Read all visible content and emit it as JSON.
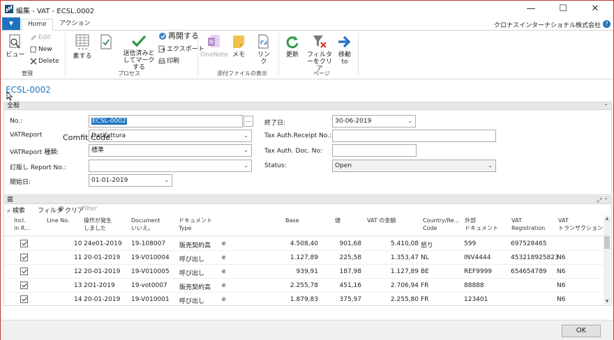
{
  "window": {
    "title": "編集 - VAT - ECSL.0002",
    "minimize": "—",
    "maximize": "☐",
    "close": "✕"
  },
  "ribbon": {
    "app_menu": "▼",
    "tabs": [
      "Home",
      "アクション"
    ],
    "company": "クロナスインターナショナル株式会社",
    "help": "?",
    "manage": {
      "view": "ビュー",
      "edit": "Edit",
      "new": "New",
      "delete": "Delete",
      "group": "管理"
    },
    "process": {
      "suggest": "素する",
      "mark_sent": "送信済みとしてマークする",
      "mark_sent_l1": "送信済みと",
      "mark_sent_l2": "してマークする",
      "reopen": "再開する",
      "export": "エクスポート",
      "print": "印刷",
      "group": "プロセス"
    },
    "attachments": {
      "onenote": "OneNote",
      "note": "メモ",
      "link": "リンク",
      "group": "添付ファイルの表示"
    },
    "page": {
      "refresh": "更新",
      "clear_filter_l1": "フィルタ",
      "clear_filter_l2": "ーをクリア",
      "goto_l1": "移動",
      "goto_l2": "to",
      "group": "ページ"
    }
  },
  "page_title": "ECSL-0002",
  "general": {
    "header": "全般",
    "fields": {
      "no_label": "No.:",
      "no_value": "ECSL-0002",
      "vat_report_config_label": "VATReport",
      "vat_report_config_value": "Datifattura",
      "vat_report_type_label": "VATReport 種類:",
      "vat_report_type_value": "標準",
      "orig_report_label": "訂版し Report No.:",
      "orig_report_value": "",
      "start_date_label": "開始日:",
      "start_date_value": "01-01-2019",
      "end_date_label": "終了日:",
      "end_date_value": "30-06-2019",
      "tax_receipt_label": "Tax Auth.Receipt No.:",
      "tax_receipt_value": "",
      "tax_doc_label": "Tax Auth. Doc. No:",
      "tax_doc_value": "",
      "status_label": "Status:",
      "status_value": "Open"
    },
    "overlay": "Comfit Code."
  },
  "lines": {
    "header": "歯",
    "toolbar": {
      "search": "検索",
      "filter": "フィルタ",
      "clear": "クリア",
      "filter_placeholder": "Filter"
    },
    "columns": {
      "incl": [
        "Incl.",
        "in R..."
      ],
      "line_no": "Line No.",
      "posting_date": [
        "操作が発生",
        "しました"
      ],
      "document_no": [
        "Document",
        "いいえ。"
      ],
      "doc_type": [
        "ドキュメント",
        "Type"
      ],
      "base": "Base",
      "amount": "値",
      "vat_amount": "VAT の金額",
      "country": [
        "Country/Re...",
        "Code"
      ],
      "ext_doc": [
        "外部",
        "ドキュメント"
      ],
      "vat_reg": [
        "VAT",
        "Registration"
      ],
      "vat_trans": [
        "VAT",
        "トランザクション"
      ]
    },
    "rows": [
      {
        "line": "10",
        "date": "24e01-2019",
        "doc": "19-108007",
        "type": "販売契約高",
        "base": "4.508,40",
        "amount": "901,68",
        "vat": "5.410,08",
        "country": "怒り",
        "ext": "599",
        "reg": "697528465",
        "trans": ""
      },
      {
        "line": "11",
        "date": "20-01-2019",
        "doc": "19-V010004",
        "type": "呼び出し",
        "base": "1.127,89",
        "amount": "225,58",
        "vat": "1.353,47",
        "country": "NL",
        "ext": "INV4444",
        "reg": "453218925823",
        "trans": "N6"
      },
      {
        "line": "12",
        "date": "20-01-2019",
        "doc": "19-V010005",
        "type": "呼び出し",
        "base": "939,91",
        "amount": "187,98",
        "vat": "1.127,89",
        "country": "BE",
        "ext": "REF9999",
        "reg": "654654789",
        "trans": "N6"
      },
      {
        "line": "13",
        "date": "2O1-2019",
        "doc": "19-vot0007",
        "type": "販売契約高",
        "base": "2.255,78",
        "amount": "451,16",
        "vat": "2.706,94",
        "country": "FR",
        "ext": "88888",
        "reg": "",
        "trans": "N6"
      },
      {
        "line": "14",
        "date": "20-01-2019",
        "doc": "19-V010001",
        "type": "呼び出し",
        "base": "1.879,83",
        "amount": "375,97",
        "vat": "2.255,80",
        "country": "FR",
        "ext": "123401",
        "reg": "",
        "trans": "N6"
      }
    ],
    "row_suffix": "e"
  },
  "footer": {
    "ok": "OK"
  },
  "colors": {
    "accent": "#1e73be",
    "window_border": "#c0392b"
  }
}
